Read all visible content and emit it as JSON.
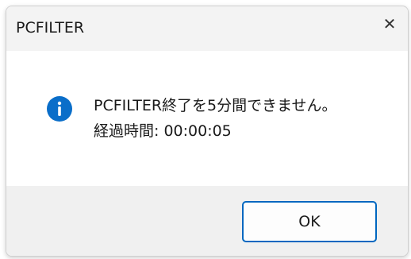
{
  "window": {
    "title": "PCFILTER",
    "close_glyph": "✕"
  },
  "dialog": {
    "icon": "info-icon",
    "message_line1": "PCFILTER終了を5分間できません。",
    "message_line2": "経過時間: 00:00:05"
  },
  "buttons": {
    "ok_label": "OK"
  },
  "colors": {
    "accent": "#0067c0",
    "info_icon": "#0a6ec9",
    "footer_bg": "#f0f0f0",
    "titlebar_bg": "#f3f3f3"
  }
}
